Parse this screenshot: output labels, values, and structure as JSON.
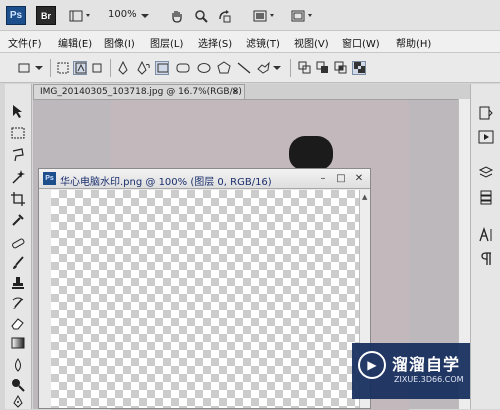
{
  "appbar": {
    "ps_logo": "Ps",
    "br_logo": "Br",
    "zoom_value": "100%"
  },
  "menu": [
    "文件(F)",
    "编辑(E)",
    "图像(I)",
    "图层(L)",
    "选择(S)",
    "滤镜(T)",
    "视图(V)",
    "窗口(W)",
    "帮助(H)"
  ],
  "doc1": {
    "title": "IMG_20140305_103718.jpg @ 16.7%(RGB/8)",
    "close_glyph": "×"
  },
  "doc2": {
    "icon": "Ps",
    "title": "华心电脑水印.png @ 100% (图层 0, RGB/16)",
    "btn_minimize": "–",
    "btn_maximize": "□",
    "btn_close": "✕"
  },
  "watermark": {
    "main": "溜溜自学",
    "sub": "ZIXUE.3D66.COM"
  },
  "colors": {
    "ps_blue": "#1d4f8c",
    "watermark_bg": "#162d5c"
  }
}
